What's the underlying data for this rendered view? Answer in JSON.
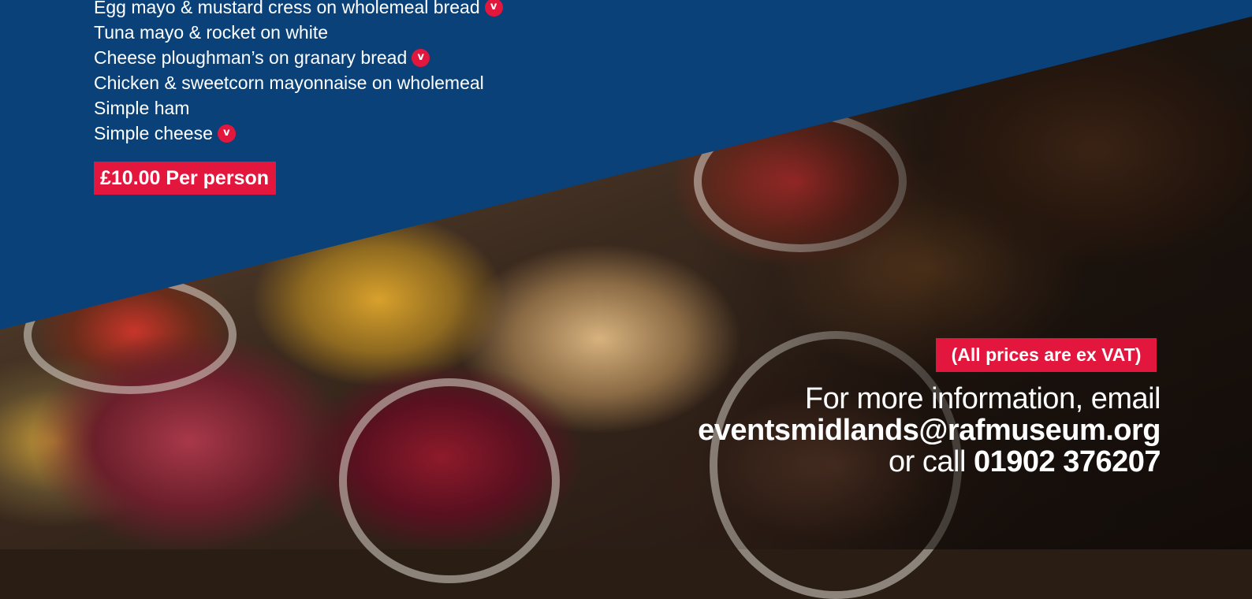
{
  "menu": {
    "items": [
      {
        "text": "Egg mayo & mustard cress on wholemeal bread",
        "badge": "v"
      },
      {
        "text": "Tuna mayo & rocket on white",
        "badge": ""
      },
      {
        "text": "Cheese ploughman’s on granary bread",
        "badge": "v"
      },
      {
        "text": "Chicken & sweetcorn mayonnaise on wholemeal",
        "badge": ""
      },
      {
        "text": "Simple ham",
        "badge": ""
      },
      {
        "text": "Simple cheese",
        "badge": "v"
      }
    ],
    "price": "£10.00 Per person"
  },
  "notice": {
    "vat": "(All prices are ex VAT)"
  },
  "contact": {
    "intro": "For more information, email",
    "email": "eventsmidlands@rafmuseum.org",
    "call_prefix": "or call",
    "phone": "01902 376207"
  },
  "colors": {
    "brand_blue": "#0a4179",
    "accent_red": "#e3173d"
  }
}
